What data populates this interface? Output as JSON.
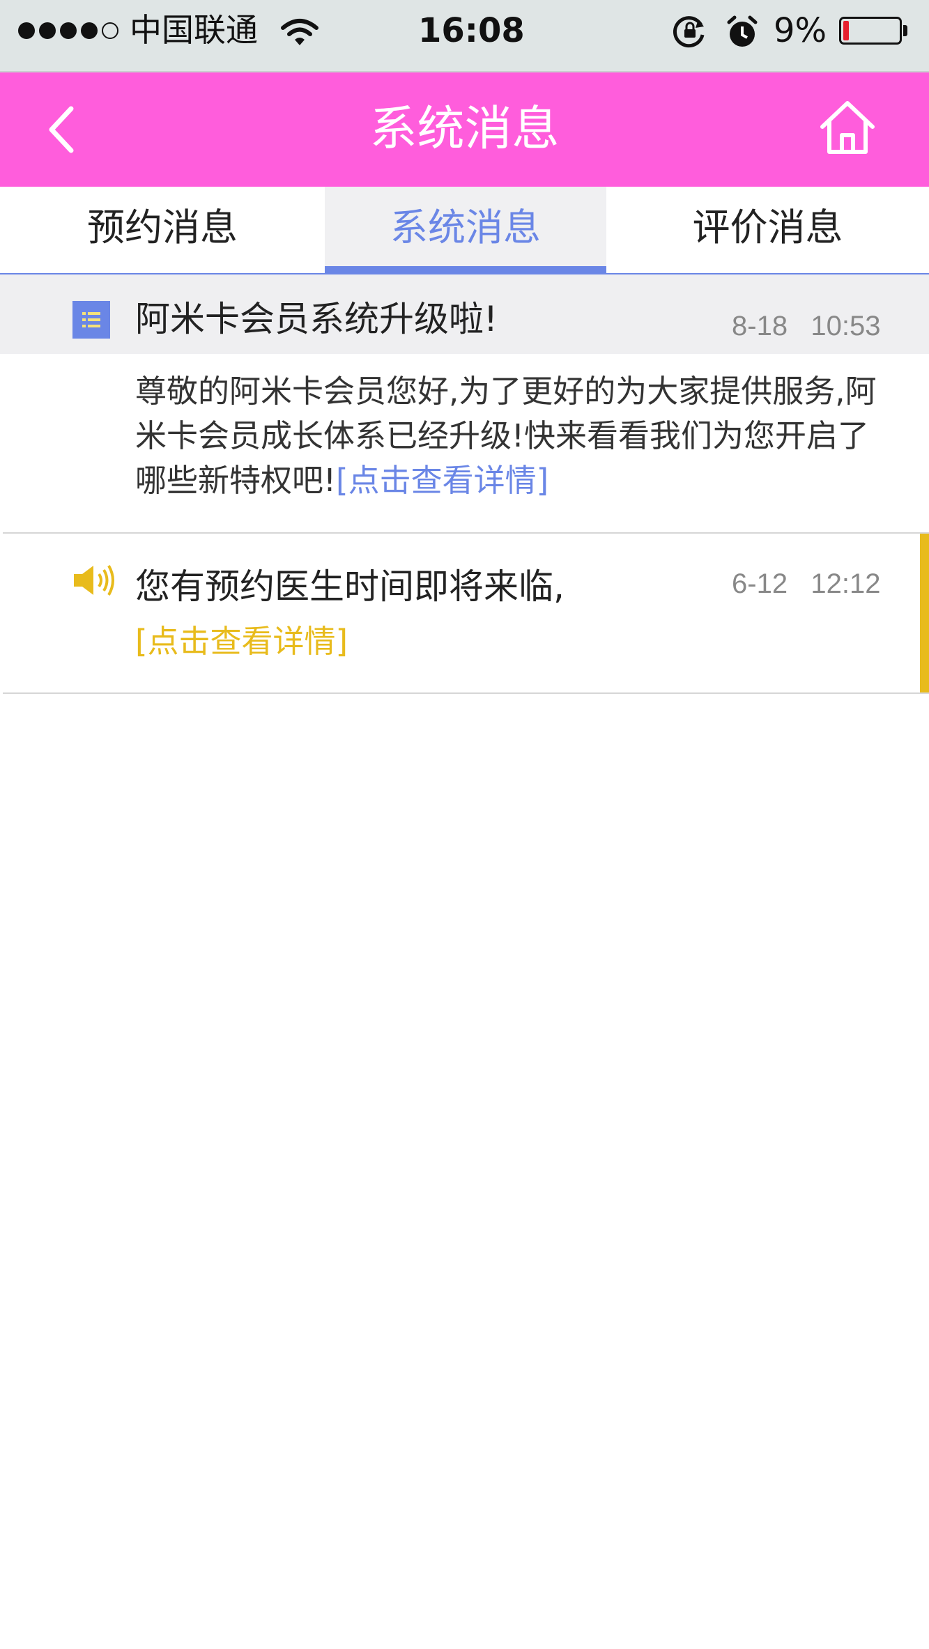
{
  "status_bar": {
    "carrier": "中国联通",
    "time": "16:08",
    "battery_percent": "9%",
    "signal_dots_filled": 4,
    "signal_dots_total": 5
  },
  "header": {
    "title": "系统消息",
    "back_icon": "chevron-left-icon",
    "home_icon": "home-icon",
    "background_color": "#ff5ddc"
  },
  "tabs": [
    {
      "label": "预约消息",
      "active": false
    },
    {
      "label": "系统消息",
      "active": true
    },
    {
      "label": "评价消息",
      "active": false
    }
  ],
  "messages": [
    {
      "icon": "list-icon",
      "title": "阿米卡会员系统升级啦!",
      "date": "8-18",
      "time": "10:53",
      "body": "尊敬的阿米卡会员您好,为了更好的为大家提供服务,阿米卡会员成长体系已经升级!快来看看我们为您开启了哪些新特权吧!",
      "link": "[点击查看详情]"
    },
    {
      "icon": "speaker-icon",
      "title": "您有预约医生时间即将来临,",
      "date": "6-12",
      "time": "12:12",
      "link": "[点击查看详情]"
    }
  ],
  "colors": {
    "accent_blue": "#6a86e6",
    "accent_yellow": "#e8bb1c",
    "header_pink": "#ff5ddc"
  }
}
